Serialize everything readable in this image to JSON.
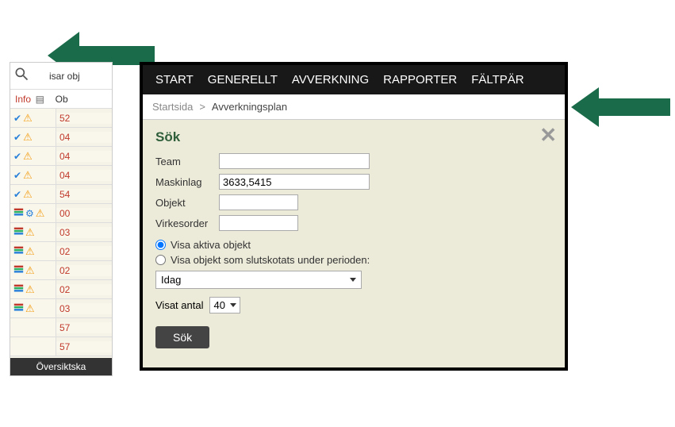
{
  "left": {
    "header_text": "isar obj",
    "col_info": "Info",
    "col_obj": "Ob",
    "rows": [
      {
        "icons": [
          "check",
          "warn"
        ],
        "val": "52"
      },
      {
        "icons": [
          "check",
          "warn"
        ],
        "val": "04"
      },
      {
        "icons": [
          "check",
          "warn"
        ],
        "val": "04"
      },
      {
        "icons": [
          "check",
          "warn"
        ],
        "val": "04"
      },
      {
        "icons": [
          "check",
          "warn"
        ],
        "val": "54"
      },
      {
        "icons": [
          "stack",
          "gear",
          "warn"
        ],
        "val": "00"
      },
      {
        "icons": [
          "stack",
          "warn"
        ],
        "val": "03"
      },
      {
        "icons": [
          "stack",
          "warn"
        ],
        "val": "02"
      },
      {
        "icons": [
          "stack",
          "warn"
        ],
        "val": "02"
      },
      {
        "icons": [
          "stack",
          "warn"
        ],
        "val": "02"
      },
      {
        "icons": [
          "stack",
          "warn"
        ],
        "val": "03"
      },
      {
        "icons": [],
        "val": "57"
      },
      {
        "icons": [],
        "val": "57"
      }
    ],
    "overview_btn": "Översiktska"
  },
  "nav": {
    "items": [
      "START",
      "GENERELLT",
      "AVVERKNING",
      "RAPPORTER",
      "FÄLTPÄR"
    ]
  },
  "breadcrumb": {
    "start": "Startsida",
    "sep": ">",
    "current": "Avverkningsplan"
  },
  "search": {
    "title": "Sök",
    "team_label": "Team",
    "team_value": "",
    "maskinlag_label": "Maskinlag",
    "maskinlag_value": "3633,5415",
    "objekt_label": "Objekt",
    "objekt_value": "",
    "virkesorder_label": "Virkesorder",
    "virkesorder_value": "",
    "radio_active": "Visa aktiva objekt",
    "radio_period": "Visa objekt som slutskotats under perioden:",
    "period_selected": "Idag",
    "count_label": "Visat antal",
    "count_value": "40",
    "button": "Sök"
  }
}
